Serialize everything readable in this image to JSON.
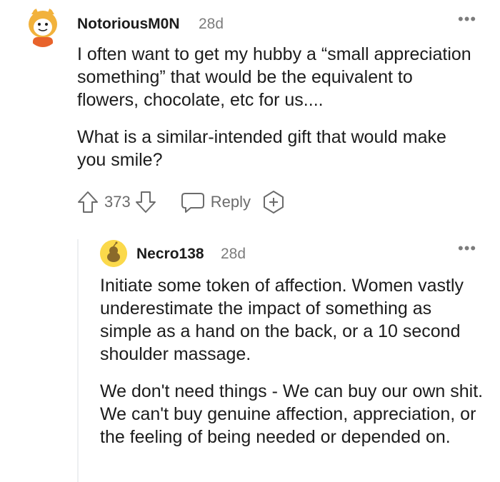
{
  "comments": [
    {
      "username": "NotoriousM0N",
      "age": "28d",
      "paragraphs": [
        "I often want to get my hubby a “small appreciation something” that would be the equivalent to flowers, chocolate, etc for us....",
        "What is a similar-intended gift that would make you smile?"
      ],
      "score": "373",
      "reply_label": "Reply"
    },
    {
      "username": "Necro138",
      "age": "28d",
      "paragraphs": [
        "Initiate some token of affection. Women vastly underestimate the impact of something as simple as a hand on the back, or a 10 second shoulder massage.",
        "We don't need things - We can buy our own shit. We can't buy genuine affection, appreciation, or the feeling of being needed or depended on."
      ]
    }
  ],
  "icons": {
    "more": "ellipsis-icon",
    "upvote": "arrow-up-icon",
    "downvote": "arrow-down-icon",
    "reply": "speech-bubble-icon",
    "award": "award-plus-icon"
  },
  "colors": {
    "text": "#1c1c1c",
    "meta": "#7c7c7c",
    "action": "#6b6b6b",
    "thread_line": "#edeff1"
  }
}
